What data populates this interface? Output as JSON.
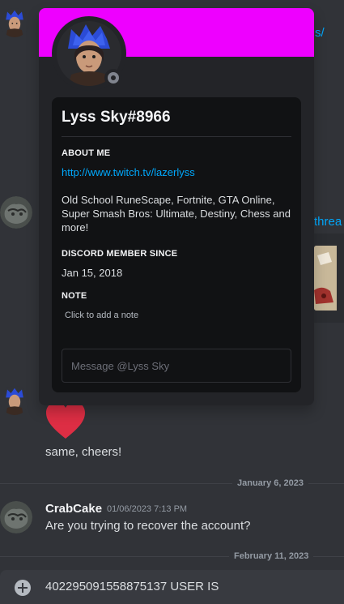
{
  "chat": {
    "top_link_fragment": "s/",
    "side_link_fragment": "threa",
    "message_same": "same, cheers!",
    "date_divider_1": "January 6, 2023",
    "crabcake": {
      "username": "CrabCake",
      "timestamp": "01/06/2023 7:13 PM",
      "text": "Are you trying to recover the account?"
    },
    "date_divider_2": "February 11, 2023"
  },
  "composer": {
    "value": "402295091558875137 USER IS"
  },
  "profile": {
    "banner_color": "#ee00ff",
    "username": "Lyss Sky#8966",
    "about_me_title": "ABOUT ME",
    "about_link": "http://www.twitch.tv/lazerlyss",
    "about_text": "Old School RuneScape, Fortnite, GTA Online, Super Smash Bros: Ultimate, Destiny, Chess and more!",
    "member_since_title": "DISCORD MEMBER SINCE",
    "member_since": "Jan 15, 2018",
    "note_title": "NOTE",
    "note_placeholder": "Click to add a note",
    "message_placeholder": "Message @Lyss Sky"
  },
  "icons": {
    "status": "offline-status-icon",
    "composer_add": "plus-circle-icon",
    "reaction": "red-heart-emoji"
  }
}
